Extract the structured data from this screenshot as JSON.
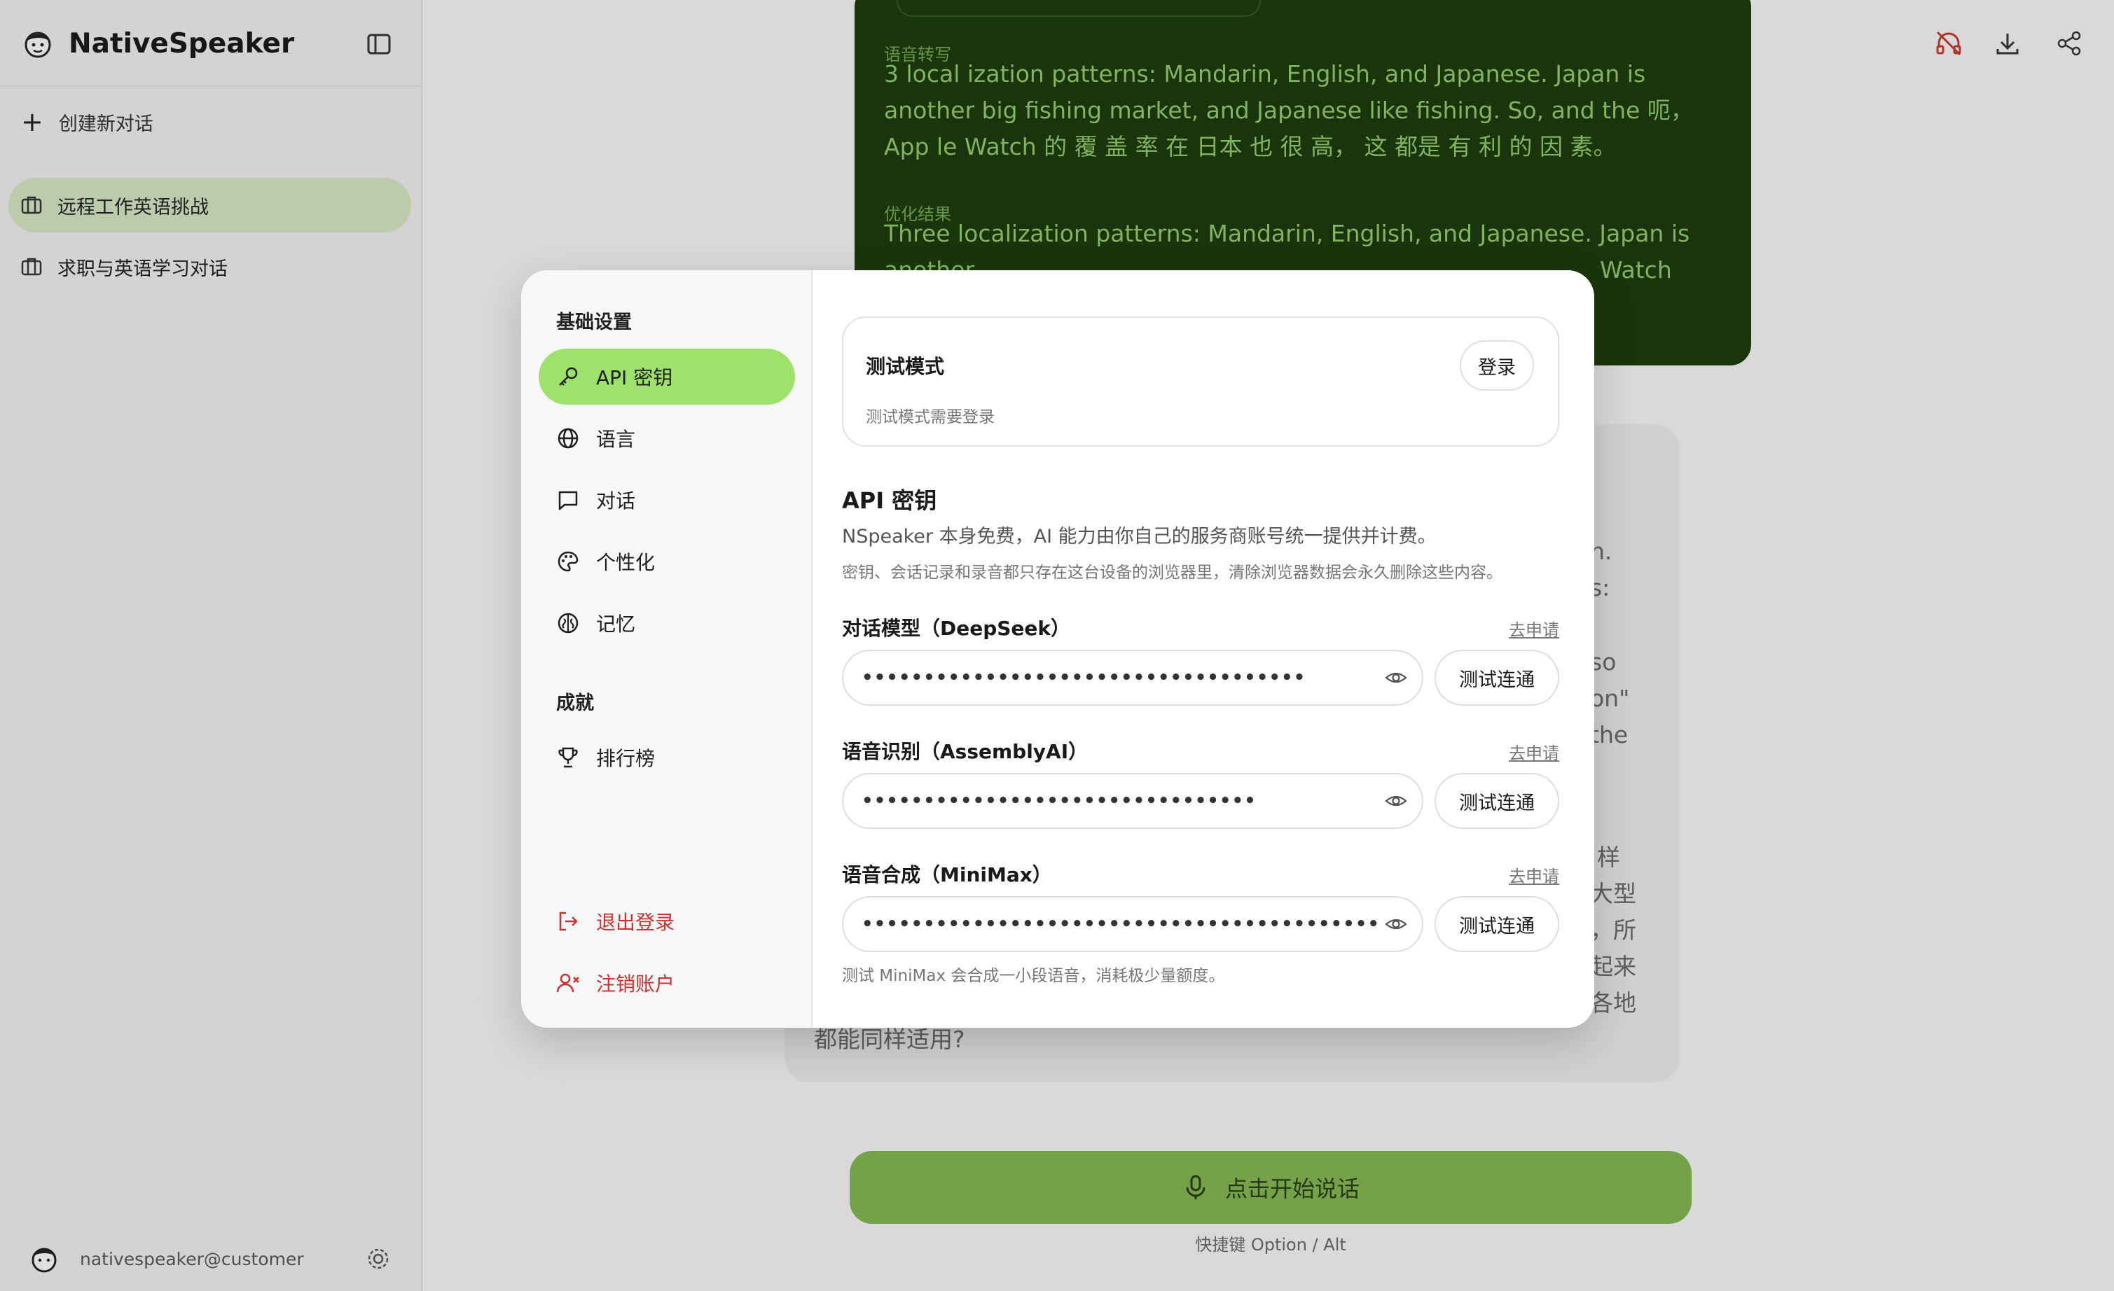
{
  "app": {
    "title": "NativeSpeaker"
  },
  "sidebar": {
    "new_chat": "创建新对话",
    "conversations": [
      {
        "label": "远程工作英语挑战",
        "active": true
      },
      {
        "label": "求职与英语学习对话",
        "active": false
      }
    ],
    "user_email": "nativespeaker@customer"
  },
  "chat": {
    "ai_message": {
      "transcript_label": "语音转写",
      "transcript_text": "3 local ization patterns: Mandarin, English, and Japanese. Japan is another big fishing market, and Japanese like fishing. So, and the 呃， App le Watch 的 覆 盖 率 在 日本 也 很 高， 这 都是 有 利 的 因 素。",
      "optimized_label": "优化结果",
      "optimized_text": "Three localization patterns: Mandarin, English, and Japanese. Japan is another",
      "optimized_tail": "Watch"
    },
    "user_message_fragments": [
      "n.",
      "s:",
      "so",
      "on\"",
      "the",
      "样",
      "大型",
      "，所",
      "起来",
      "各地"
    ],
    "user_message_last_line": "都能同样适用?",
    "speak_button": "点击开始说话",
    "hotkey_hint": "快捷键 Option / Alt"
  },
  "settings_modal": {
    "nav_basic_heading": "基础设置",
    "nav_items": [
      {
        "label": "API 密钥",
        "icon": "key-icon",
        "active": true
      },
      {
        "label": "语言",
        "icon": "globe-icon",
        "active": false
      },
      {
        "label": "对话",
        "icon": "message-icon",
        "active": false
      },
      {
        "label": "个性化",
        "icon": "palette-icon",
        "active": false
      },
      {
        "label": "记忆",
        "icon": "brain-icon",
        "active": false
      }
    ],
    "nav_achievement_heading": "成就",
    "nav_leaderboard": "排行榜",
    "logout": "退出登录",
    "delete_account": "注销账户",
    "test_mode": {
      "title": "测试模式",
      "description": "测试模式需要登录",
      "login_button": "登录"
    },
    "api_section": {
      "title": "API 密钥",
      "description": "NSpeaker 本身免费，AI 能力由你自己的服务商账号统一提供并计费。",
      "note": "密钥、会话记录和录音都只存在这台设备的浏览器里，清除浏览器数据会永久删除这些内容。"
    },
    "fields": [
      {
        "label": "对话模型（DeepSeek）",
        "apply": "去申请",
        "masked_value": "••••••••••••••••••••••••••••••••••••",
        "test_button": "测试连通"
      },
      {
        "label": "语音识别（AssemblyAI）",
        "apply": "去申请",
        "masked_value": "••••••••••••••••••••••••••••••••",
        "test_button": "测试连通"
      },
      {
        "label": "语音合成（MiniMax）",
        "apply": "去申请",
        "masked_value": "••••••••••••••••••••••••••••••••••••••••••••••••••••••••••••••••••••••",
        "test_button": "测试连通"
      }
    ],
    "minimax_note": "测试 MiniMax 会合成一小段语音，消耗极少量额度。"
  },
  "colors": {
    "accent_green": "#9ee16b",
    "speak_button_green": "#7fb050",
    "ai_bubble_dark": "#1d3a0d",
    "danger_red": "#d03030"
  }
}
